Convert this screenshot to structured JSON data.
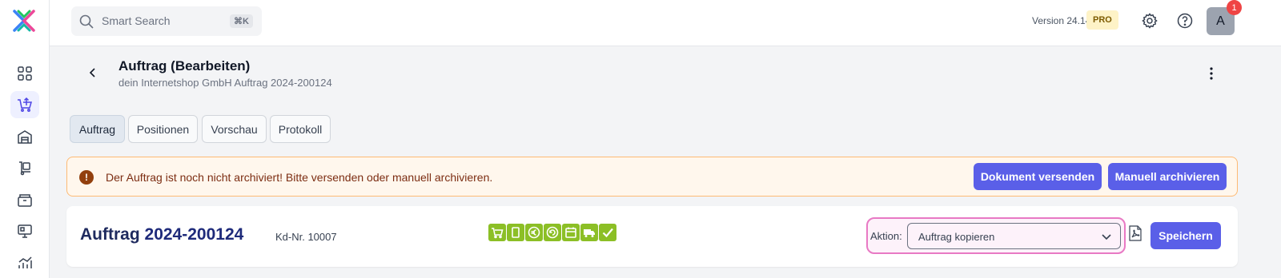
{
  "header": {
    "search_placeholder": "Smart Search",
    "search_shortcut": "⌘K",
    "version": "Version 24.14.6",
    "badge": "PRO",
    "avatar_initial": "A",
    "notification_count": "1"
  },
  "sidebar": {
    "items": [
      {
        "icon": "dashboard-grid-icon"
      },
      {
        "icon": "cart-upload-icon",
        "active": true
      },
      {
        "icon": "warehouse-icon"
      },
      {
        "icon": "trolley-icon"
      },
      {
        "icon": "archive-box-icon"
      },
      {
        "icon": "pos-terminal-icon"
      },
      {
        "icon": "analytics-chart-icon"
      }
    ]
  },
  "page": {
    "title": "Auftrag (Bearbeiten)",
    "subtitle": "dein Internetshop GmbH Auftrag 2024-200124"
  },
  "tabs": [
    {
      "label": "Auftrag",
      "active": true
    },
    {
      "label": "Positionen"
    },
    {
      "label": "Vorschau"
    },
    {
      "label": "Protokoll"
    }
  ],
  "alert": {
    "message": "Der Auftrag ist noch nicht archiviert! Bitte versenden oder manuell archivieren.",
    "send_button": "Dokument versenden",
    "archive_button": "Manuell archivieren"
  },
  "order": {
    "title_prefix": "Auftrag",
    "number": "2024-200124",
    "customer_number": "Kd-Nr. 10007",
    "status_icons": [
      "cart-icon",
      "document-icon",
      "euro-icon",
      "return-icon",
      "calendar-icon",
      "truck-icon",
      "check-icon"
    ],
    "action_label": "Aktion:",
    "action_value": "Auftrag kopieren",
    "save_button": "Speichern"
  },
  "colors": {
    "accent": "#5a5fe8",
    "status_green": "#8cbf26",
    "alert_border": "#fdba74",
    "highlight_pink": "#e879c4"
  }
}
